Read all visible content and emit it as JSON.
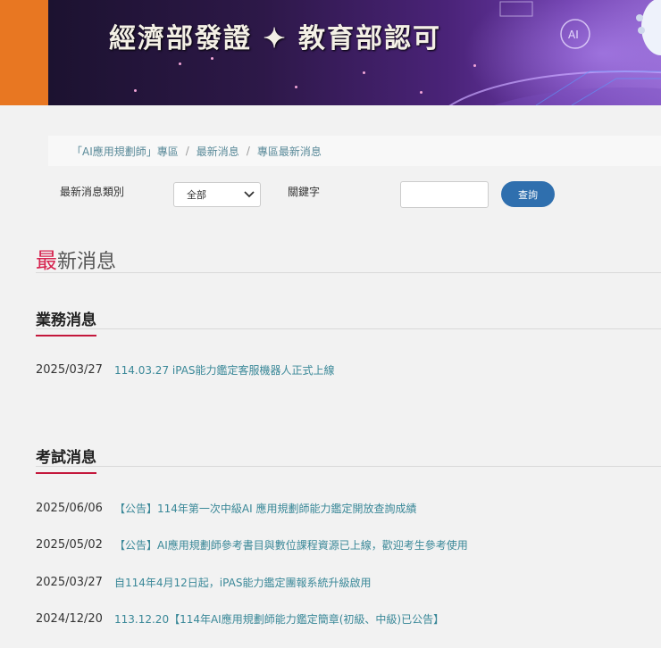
{
  "banner": {
    "title": "經濟部發證 ✦ 教育部認可"
  },
  "breadcrumb": {
    "items": [
      "「AI應用規劃師」專區",
      "最新消息",
      "專區最新消息"
    ]
  },
  "filter": {
    "category_label": "最新消息類別",
    "category_value": "全部",
    "keyword_label": "關鍵字",
    "keyword_value": "",
    "search_label": "查詢"
  },
  "page_title": {
    "accent": "最",
    "rest": "新消息"
  },
  "sections": [
    {
      "title": "業務消息",
      "items": [
        {
          "date": "2025/03/27",
          "text": "114.03.27 iPAS能力鑑定客服機器人正式上線"
        }
      ]
    },
    {
      "title": "考試消息",
      "items": [
        {
          "date": "2025/06/06",
          "text": "【公告】114年第一次中級AI 應用規劃師能力鑑定開放查詢成績"
        },
        {
          "date": "2025/05/02",
          "text": "【公告】AI應用規劃師參考書目與數位課程資源已上線，歡迎考生參考使用"
        },
        {
          "date": "2025/03/27",
          "text": "自114年4月12日起，iPAS能力鑑定團報系統升級啟用"
        },
        {
          "date": "2024/12/20",
          "text": "113.12.20【114年AI應用規劃師能力鑑定簡章(初級、中級)已公告】"
        }
      ]
    }
  ],
  "colors": {
    "orange": "#e87722",
    "accent_red": "#d6234f",
    "link": "#3a8898",
    "button": "#2f6fae"
  }
}
